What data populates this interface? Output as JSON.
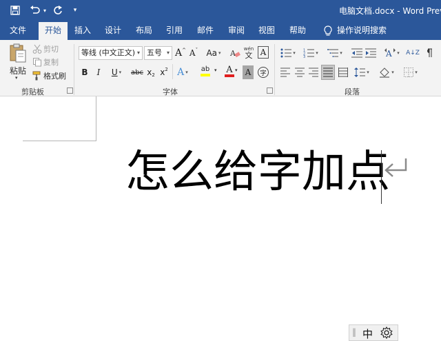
{
  "window": {
    "title": "电脑文档.docx - Word Previe"
  },
  "quick_access": {
    "customize_caret": "▾"
  },
  "tabs": [
    {
      "label": "文件"
    },
    {
      "label": "开始"
    },
    {
      "label": "插入"
    },
    {
      "label": "设计"
    },
    {
      "label": "布局"
    },
    {
      "label": "引用"
    },
    {
      "label": "邮件"
    },
    {
      "label": "审阅"
    },
    {
      "label": "视图"
    },
    {
      "label": "帮助"
    }
  ],
  "tell_me": {
    "label": "操作说明搜索"
  },
  "clipboard": {
    "paste_label": "粘贴",
    "cut_label": "剪切",
    "copy_label": "复制",
    "format_painter_label": "格式刷",
    "group_label": "剪贴板"
  },
  "font": {
    "font_name": "等线 (中文正文)",
    "font_size": "五号",
    "grow_glyph": "A",
    "shrink_glyph": "A",
    "case_glyph": "Aa",
    "phonetic_glyph": "wén",
    "border_glyph": "A",
    "bold_glyph": "B",
    "italic_glyph": "I",
    "underline_glyph": "U",
    "strike_glyph": "abc",
    "subscript_glyph": "x",
    "superscript_glyph": "x",
    "sub_mark": "2",
    "sup_mark": "2",
    "effects_glyph": "A",
    "highlight_glyph": "ab",
    "font_color_glyph": "A",
    "shading_glyph": "A",
    "enclose_glyph": "字",
    "group_label": "字体"
  },
  "paragraph": {
    "sort_glyph": "A↓Z",
    "group_label": "段落"
  },
  "colors": {
    "brand": "#2b579a",
    "highlight": "#ffff00",
    "font_color": "#e01f1f"
  },
  "document": {
    "text": "怎么给字加点"
  },
  "ime": {
    "mode": "中",
    "divider": "‖"
  }
}
